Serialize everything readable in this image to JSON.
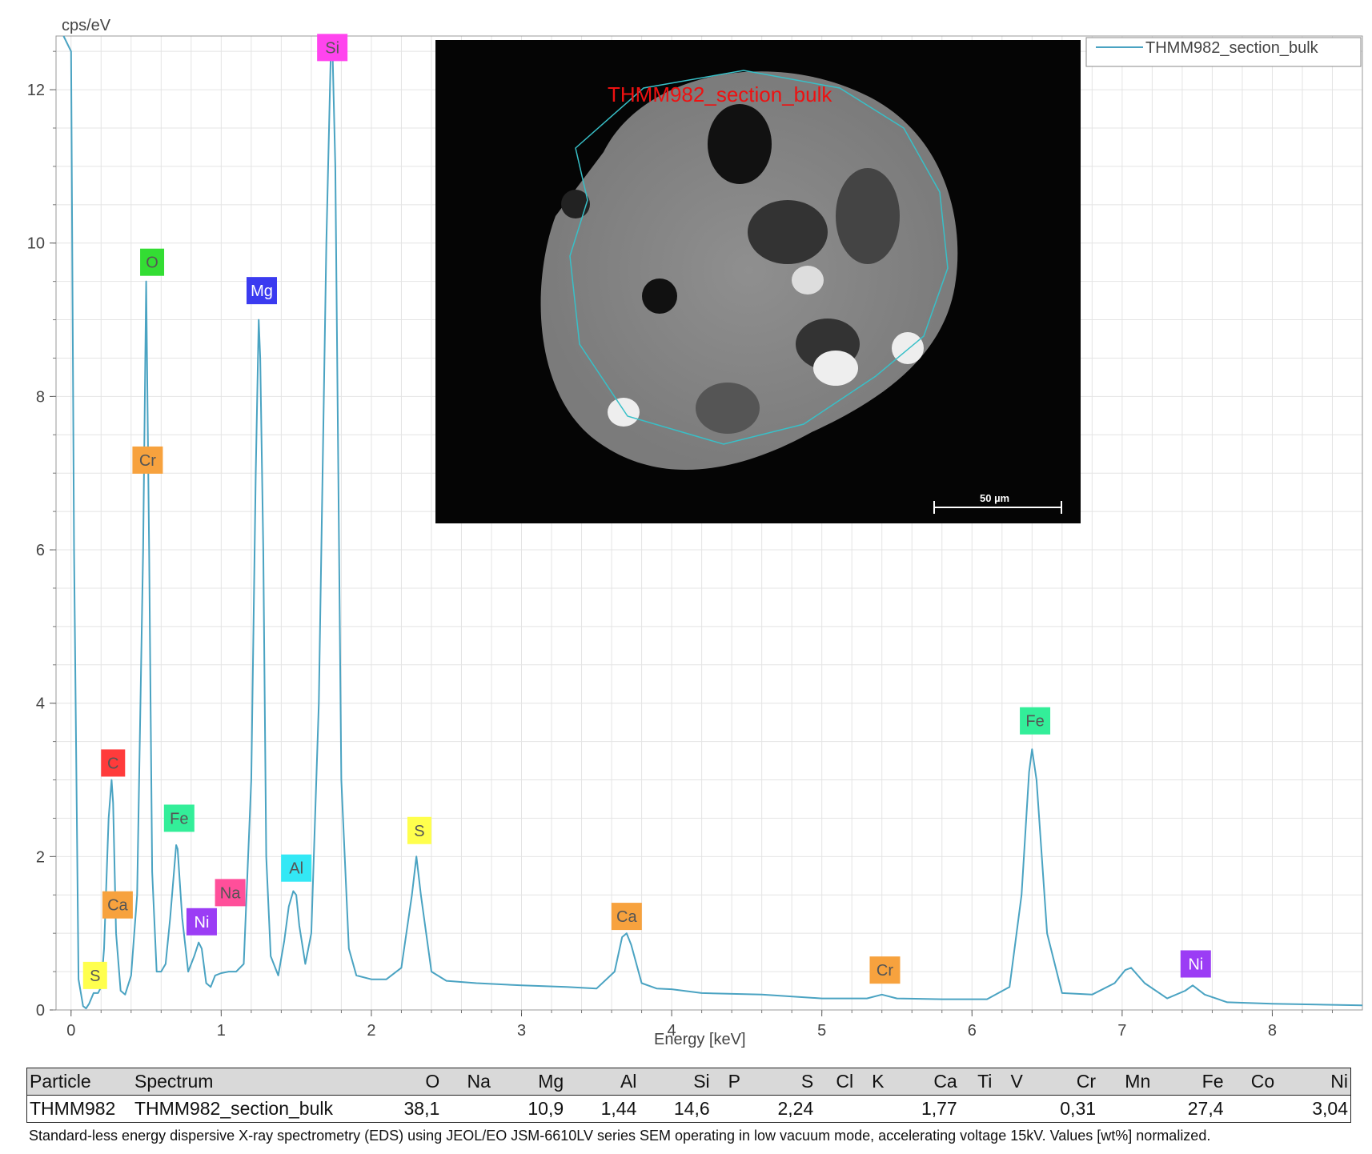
{
  "chart_data": {
    "type": "line",
    "ylabel": "cps/eV",
    "xlabel": "Energy [keV]",
    "xlim": [
      -0.1,
      8.6
    ],
    "ylim": [
      0,
      12.7
    ],
    "x_ticks": [
      0,
      1,
      2,
      3,
      4,
      5,
      6,
      7,
      8
    ],
    "y_ticks": [
      0,
      2,
      4,
      6,
      8,
      10,
      12
    ],
    "grid": true,
    "legend_position": "top-right",
    "series": [
      {
        "name": "THMM982_section_bulk",
        "color": "#4aa3c2",
        "x": [
          -0.05,
          0.0,
          0.02,
          0.05,
          0.08,
          0.1,
          0.12,
          0.15,
          0.18,
          0.2,
          0.22,
          0.25,
          0.27,
          0.28,
          0.3,
          0.33,
          0.36,
          0.4,
          0.44,
          0.48,
          0.5,
          0.52,
          0.54,
          0.57,
          0.6,
          0.63,
          0.66,
          0.7,
          0.71,
          0.74,
          0.78,
          0.82,
          0.85,
          0.87,
          0.9,
          0.93,
          0.96,
          1.0,
          1.05,
          1.1,
          1.15,
          1.2,
          1.23,
          1.25,
          1.26,
          1.28,
          1.3,
          1.33,
          1.38,
          1.42,
          1.45,
          1.48,
          1.5,
          1.52,
          1.56,
          1.6,
          1.65,
          1.7,
          1.73,
          1.74,
          1.76,
          1.8,
          1.85,
          1.9,
          2.0,
          2.1,
          2.2,
          2.27,
          2.3,
          2.33,
          2.4,
          2.5,
          2.7,
          3.0,
          3.3,
          3.5,
          3.62,
          3.67,
          3.7,
          3.73,
          3.8,
          3.9,
          4.0,
          4.2,
          4.6,
          5.0,
          5.3,
          5.4,
          5.5,
          5.8,
          6.1,
          6.25,
          6.33,
          6.38,
          6.4,
          6.43,
          6.5,
          6.6,
          6.8,
          6.95,
          7.02,
          7.06,
          7.15,
          7.3,
          7.42,
          7.47,
          7.55,
          7.7,
          8.0,
          8.3,
          8.6
        ],
        "y": [
          12.7,
          12.5,
          6.0,
          0.4,
          0.05,
          0.02,
          0.08,
          0.22,
          0.22,
          0.3,
          0.8,
          2.5,
          3.0,
          2.7,
          1.0,
          0.25,
          0.2,
          0.45,
          1.5,
          6.0,
          9.5,
          6.0,
          1.8,
          0.5,
          0.5,
          0.6,
          1.2,
          2.15,
          2.1,
          1.2,
          0.5,
          0.7,
          0.88,
          0.8,
          0.35,
          0.3,
          0.45,
          0.48,
          0.5,
          0.5,
          0.6,
          3.0,
          7.0,
          9.0,
          8.5,
          6.0,
          2.0,
          0.7,
          0.45,
          0.9,
          1.35,
          1.55,
          1.5,
          1.1,
          0.6,
          1.0,
          4.0,
          10.0,
          12.5,
          12.6,
          11.0,
          3.0,
          0.8,
          0.45,
          0.4,
          0.4,
          0.55,
          1.5,
          2.0,
          1.5,
          0.5,
          0.38,
          0.35,
          0.32,
          0.3,
          0.28,
          0.5,
          0.95,
          1.0,
          0.85,
          0.35,
          0.28,
          0.27,
          0.22,
          0.2,
          0.15,
          0.15,
          0.2,
          0.15,
          0.14,
          0.14,
          0.3,
          1.5,
          3.1,
          3.4,
          3.0,
          1.0,
          0.22,
          0.2,
          0.35,
          0.52,
          0.55,
          0.35,
          0.15,
          0.25,
          0.32,
          0.2,
          0.1,
          0.08,
          0.07,
          0.06
        ]
      }
    ],
    "element_labels": [
      {
        "text": "S",
        "x": 0.16,
        "y": 0.45,
        "color": "#ffff4d"
      },
      {
        "text": "C",
        "x": 0.28,
        "y": 3.22,
        "color": "#ff3b3b"
      },
      {
        "text": "Ca",
        "x": 0.31,
        "y": 1.37,
        "color": "#f7a23e"
      },
      {
        "text": "O",
        "x": 0.54,
        "y": 9.75,
        "color": "#33dd33"
      },
      {
        "text": "Cr",
        "x": 0.51,
        "y": 7.17,
        "color": "#f7a23e"
      },
      {
        "text": "Fe",
        "x": 0.72,
        "y": 2.5,
        "color": "#33ee99"
      },
      {
        "text": "Ni",
        "x": 0.87,
        "y": 1.15,
        "color": "#9b3df5"
      },
      {
        "text": "Na",
        "x": 1.06,
        "y": 1.53,
        "color": "#ff4f9a"
      },
      {
        "text": "Mg",
        "x": 1.27,
        "y": 9.38,
        "color": "#3b3bf0"
      },
      {
        "text": "Al",
        "x": 1.5,
        "y": 1.85,
        "color": "#33e8f5"
      },
      {
        "text": "Si",
        "x": 1.74,
        "y": 12.55,
        "color": "#ff44ee"
      },
      {
        "text": "S",
        "x": 2.32,
        "y": 2.34,
        "color": "#ffff4d"
      },
      {
        "text": "Ca",
        "x": 3.7,
        "y": 1.22,
        "color": "#f7a23e"
      },
      {
        "text": "Cr",
        "x": 5.42,
        "y": 0.52,
        "color": "#f7a23e"
      },
      {
        "text": "Fe",
        "x": 6.42,
        "y": 3.77,
        "color": "#33ee99"
      },
      {
        "text": "Ni",
        "x": 7.49,
        "y": 0.6,
        "color": "#9b3df5"
      }
    ]
  },
  "inset": {
    "label": "THMM982_section_bulk",
    "scale_label": "50 µm"
  },
  "table": {
    "headers": [
      "Particle",
      "Spectrum",
      "O",
      "Na",
      "Mg",
      "Al",
      "Si",
      "P",
      "S",
      "Cl",
      "K",
      "Ca",
      "Ti",
      "V",
      "Cr",
      "Mn",
      "Fe",
      "Co",
      "Ni"
    ],
    "row": [
      "THMM982",
      "THMM982_section_bulk",
      "38,1",
      "",
      "10,9",
      "1,44",
      "14,6",
      "",
      "2,24",
      "",
      "",
      "1,77",
      "",
      "",
      "0,31",
      "",
      "27,4",
      "",
      "3,04"
    ]
  },
  "footnote": "Standard-less energy dispersive X-ray spectrometry (EDS) using JEOL/EO JSM-6610LV series SEM operating in low vacuum mode, accelerating voltage 15kV. Values [wt%] normalized."
}
